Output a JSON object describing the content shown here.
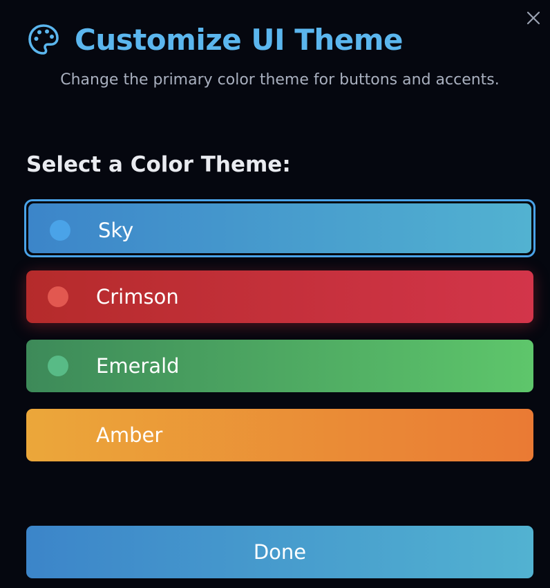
{
  "dialog": {
    "title": "Customize UI Theme",
    "subtitle": "Change the primary color theme for buttons and accents.",
    "title_icon": "palette-icon",
    "close_icon": "close-icon",
    "section_label": "Select a Color Theme:",
    "themes": [
      {
        "label": "Sky",
        "selected": true,
        "dot_color": "#4aa3e8",
        "gradient": [
          "#3c85c9",
          "#52b2d1"
        ]
      },
      {
        "label": "Crimson",
        "selected": false,
        "dot_color": "#e25850",
        "gradient": [
          "#b52b2b",
          "#d3354a"
        ]
      },
      {
        "label": "Emerald",
        "selected": false,
        "dot_color": "#58bb86",
        "gradient": [
          "#3d8a59",
          "#5ec66b"
        ]
      },
      {
        "label": "Amber",
        "selected": false,
        "dot_color": null,
        "gradient": [
          "#eba73a",
          "#ea7a34"
        ]
      }
    ],
    "done_label": "Done"
  },
  "colors": {
    "background": "#05070f",
    "title": "#5bb6ee",
    "subtitle": "#a9b0bf",
    "selected_border": "#4aa3e8",
    "done_gradient": [
      "#3c85c9",
      "#52b2d1"
    ]
  }
}
